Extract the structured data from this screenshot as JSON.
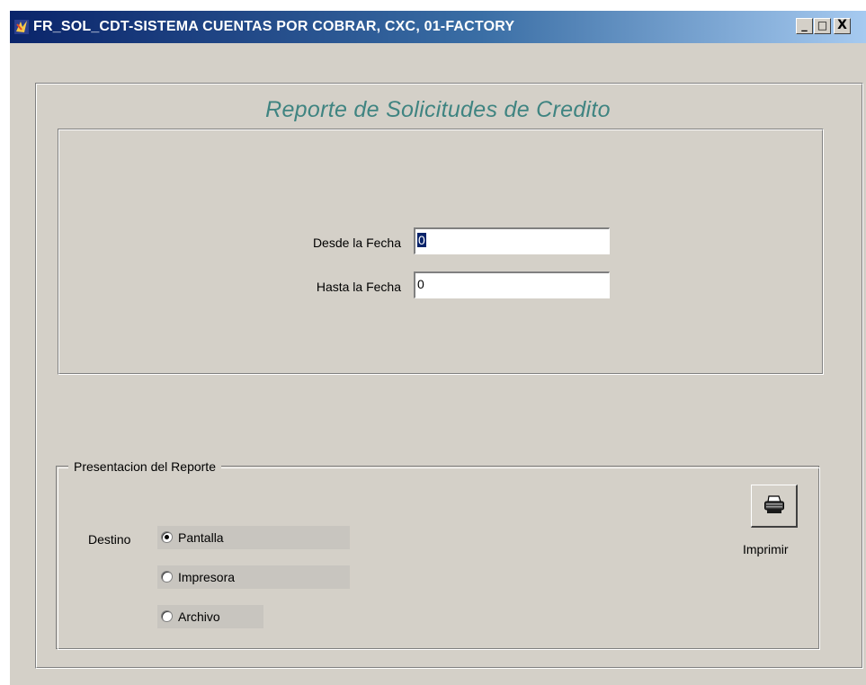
{
  "window": {
    "title": "FR_SOL_CDT-SISTEMA CUENTAS POR COBRAR, CXC, 01-FACTORY",
    "controls": {
      "minimize": "_",
      "maximize": "□",
      "close": "X"
    }
  },
  "report": {
    "title": "Reporte de Solicitudes de Credito"
  },
  "fields": {
    "desde_label": "Desde la Fecha",
    "desde_value": "0",
    "hasta_label": "Hasta la Fecha",
    "hasta_value": "0"
  },
  "presentation": {
    "group_label": "Presentacion del Reporte",
    "destino_label": "Destino",
    "options": [
      {
        "label": "Pantalla",
        "selected": true
      },
      {
        "label": "Impresora",
        "selected": false
      },
      {
        "label": "Archivo",
        "selected": false
      }
    ]
  },
  "actions": {
    "print_label": "Imprimir",
    "print_icon": "printer-icon"
  },
  "colors": {
    "title_text": "#3f8481",
    "titlebar": "#0a246a",
    "face": "#d4d0c8"
  }
}
